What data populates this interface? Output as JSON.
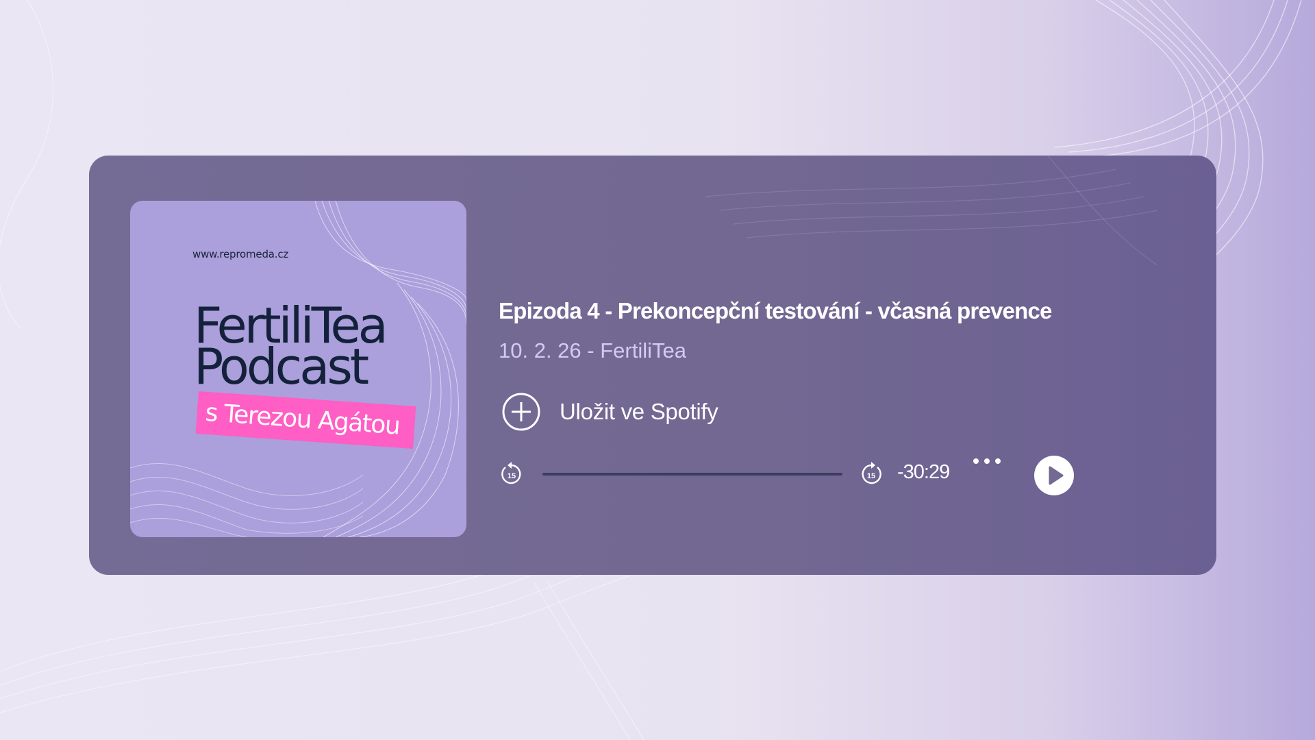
{
  "cover": {
    "url": "www.repromeda.cz",
    "title_line1": "FertiliTea",
    "title_line2": "Podcast",
    "ribbon": "s Terezou Agátou",
    "bg_color": "#ab9fdc",
    "ribbon_color": "#ff5ec4"
  },
  "episode": {
    "title": "Epizoda 4 - Prekoncepční testování - včasná prevence",
    "date": "10. 2. 26",
    "show": "- FertiliTea"
  },
  "actions": {
    "save_label": "Uložit ve Spotify",
    "save_icon": "plus-circle-icon",
    "more_icon": "more-dots-icon"
  },
  "player": {
    "skip_back_label": "15",
    "skip_forward_label": "15",
    "remaining_time": "-30:29",
    "progress": 0,
    "play_icon": "play-icon"
  },
  "colors": {
    "card": "#736992",
    "accent_white": "#ffffff",
    "meta_text": "#d4cbf0"
  }
}
